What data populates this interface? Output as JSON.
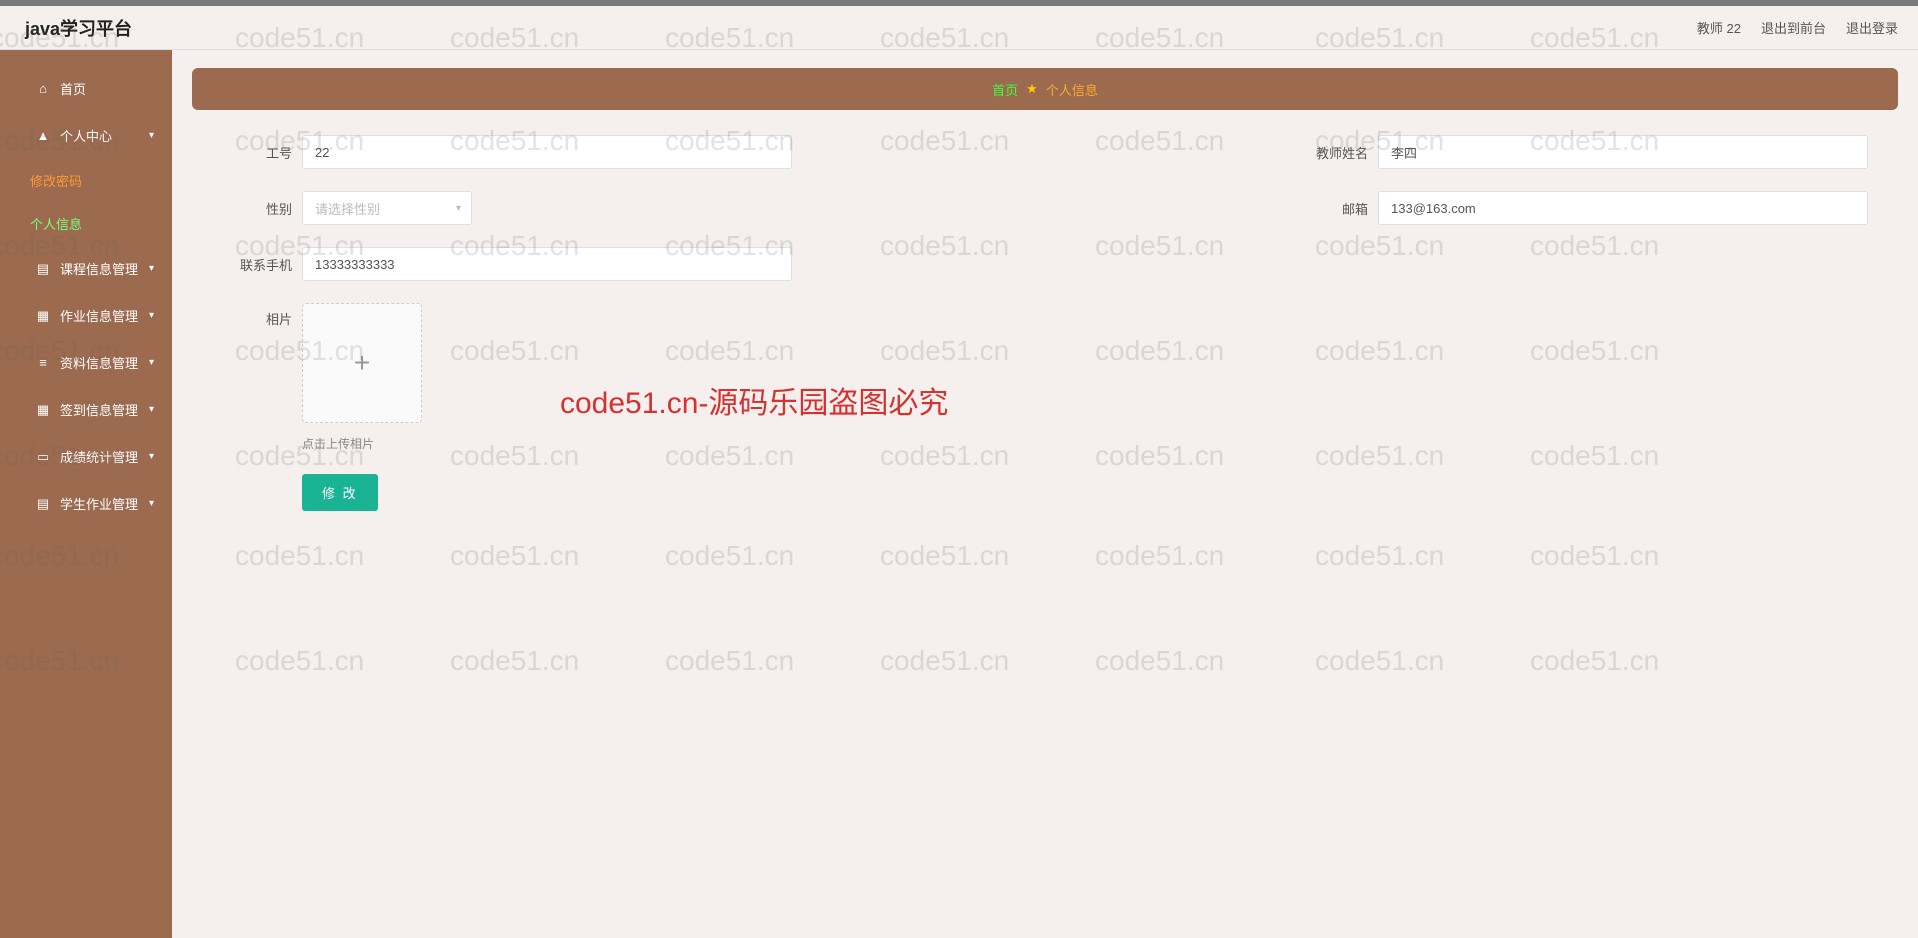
{
  "header": {
    "title": "java学习平台",
    "user": "教师 22",
    "back_front": "退出到前台",
    "logout": "退出登录"
  },
  "sidebar": {
    "home": "首页",
    "personal_center": "个人中心",
    "change_password": "修改密码",
    "personal_info": "个人信息",
    "course_mgmt": "课程信息管理",
    "homework_mgmt": "作业信息管理",
    "material_mgmt": "资料信息管理",
    "signin_mgmt": "签到信息管理",
    "grade_mgmt": "成绩统计管理",
    "student_hw_mgmt": "学生作业管理"
  },
  "breadcrumb": {
    "home": "首页",
    "current": "个人信息"
  },
  "form": {
    "emp_id_label": "工号",
    "emp_id_value": "22",
    "teacher_name_label": "教师姓名",
    "teacher_name_value": "李四",
    "gender_label": "性别",
    "gender_placeholder": "请选择性别",
    "email_label": "邮箱",
    "email_value": "133@163.com",
    "phone_label": "联系手机",
    "phone_value": "13333333333",
    "photo_label": "相片",
    "upload_hint": "点击上传相片",
    "submit": "修 改"
  },
  "watermark": {
    "text": "code51.cn",
    "red_text": "code51.cn-源码乐园盗图必究"
  }
}
